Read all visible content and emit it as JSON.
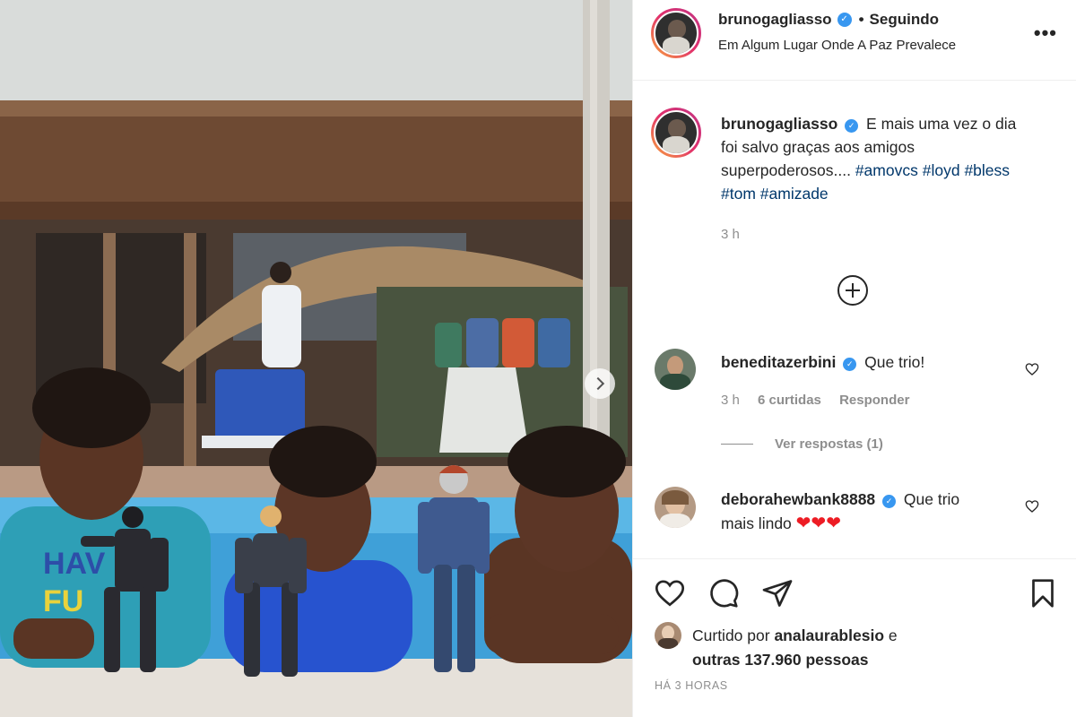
{
  "photo": {
    "description_hidden": "",
    "next_icon": "chevron-right-icon"
  },
  "header": {
    "username": "brunogagliasso",
    "separator": "•",
    "follow_status": "Seguindo",
    "location": "Em Algum Lugar Onde A Paz Prevalece",
    "more_label": "•••"
  },
  "caption": {
    "username": "brunogagliasso",
    "text": "E mais uma vez o dia foi salvo graças aos amigos superpoderosos....",
    "hashtags": [
      "#amovcs",
      "#loyd",
      "#bless",
      "#tom",
      "#amizade"
    ],
    "time": "3 h"
  },
  "comments": [
    {
      "username": "beneditazerbini",
      "text": "Que trio!",
      "time": "3 h",
      "likes": "6 curtidas",
      "reply_label": "Responder",
      "view_replies": "Ver respostas (1)"
    },
    {
      "username": "deborahewbank8888",
      "text": "Que trio mais lindo",
      "emoji": "❤❤❤"
    }
  ],
  "footer": {
    "liked_prefix": "Curtido por",
    "liked_user": "analaurablesio",
    "liked_and": "e",
    "liked_others": "outras 137.960 pessoas",
    "posted": "HÁ 3 HORAS"
  },
  "colors": {
    "verified": "#3897f0",
    "hashtag": "#00376b",
    "muted": "#8e8e8e",
    "heart": "#ed1c24"
  }
}
